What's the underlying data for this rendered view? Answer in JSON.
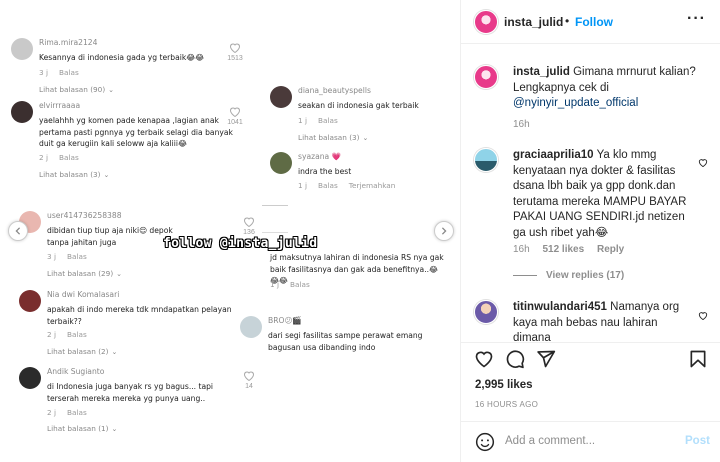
{
  "media": {
    "watermark": "follow @insta_julid",
    "comments_left": [
      {
        "name": "Rima.mira2124",
        "text": "Kesannya di indonesia gada yg terbaik😂😂",
        "time": "3 j",
        "reply": "Balas",
        "likes": "1513",
        "replies": "Lihat balasan (90)"
      },
      {
        "name": "elvirrraaaa",
        "text": "yaelahhh yg komen pade kenapaa ,lagian anak pertama pasti pgnnya yg terbaik selagi dia banyak duit ga kerugiin kali seloww aja kaliii😂",
        "time": "2 j",
        "reply": "Balas",
        "likes": "1041",
        "replies": "Lihat balasan (3)"
      },
      {
        "name": "user414736258388",
        "text": "dibidan tiup tiup aja niki😌 depok tanpa jahitan juga",
        "time": "3 j",
        "reply": "Balas",
        "likes": "136",
        "replies": "Lihat balasan (29)"
      },
      {
        "name": "Nia dwi Komalasari",
        "text": "apakah di indo mereka tdk mndapatkan pelayan terbaik??",
        "time": "2 j",
        "reply": "Balas",
        "likes": "",
        "replies": "Lihat balasan (2)"
      },
      {
        "name": "Andik Sugianto",
        "text": "di Indonesia juga banyak rs yg bagus... tapi terserah mereka mereka yg punya uang..",
        "time": "2 j",
        "reply": "Balas",
        "likes": "14",
        "replies": "Lihat balasan (1)"
      }
    ],
    "comments_right": [
      {
        "name": "diana_beautyspells",
        "text": "seakan di indonesia gak terbaik",
        "time": "1 j",
        "reply": "Balas",
        "replies": "Lihat balasan (3)"
      },
      {
        "name": "syazana 💗",
        "text": "indra the best",
        "time": "1 j",
        "reply": "Balas",
        "translate": "Terjemahkan"
      },
      {
        "name": "",
        "text": "jd maksutnya lahiran di indonesia RS nya gak baik fasilitasnya dan gak ada benefitnya..😂😂😂",
        "time": "1 j",
        "reply": "Balas"
      },
      {
        "name": "BRO😕🎬",
        "text": "dari segi fasilitas sampe perawat emang bagusan usa dibanding indo",
        "time": "",
        "reply": ""
      }
    ]
  },
  "header": {
    "username": "insta_julid",
    "dot": "•",
    "follow": "Follow",
    "more": "···"
  },
  "caption": {
    "username": "insta_julid",
    "text": "Gimana mrnurut kalian? Lengkapnya cek di",
    "mention": "@nyinyir_update_official",
    "time": "16h"
  },
  "comments": [
    {
      "username": "graciaaprilia10",
      "text": "Ya klo mmg kenyataan nya dokter & fasilitas dsana lbh baik ya gpp donk.dan terutama mereka MAMPU BAYAR PAKAI UANG SENDIRI.jd netizen ga ush ribet yah😂",
      "time": "16h",
      "likes": "512 likes",
      "reply": "Reply",
      "view_replies": "View replies (17)"
    },
    {
      "username": "titinwulandari451",
      "text": "Namanya org kaya mah bebas nau lahiran dimana"
    }
  ],
  "actions": {
    "like_icon": "heart-icon",
    "comment_icon": "comment-icon",
    "share_icon": "share-icon",
    "save_icon": "bookmark-icon"
  },
  "likes": "2,995 likes",
  "posted": "16 HOURS AGO",
  "add_comment": {
    "placeholder": "Add a comment...",
    "post": "Post"
  },
  "colors": {
    "follow": "#0095f6",
    "link": "#00376b",
    "post_disabled": "#b2dffc"
  }
}
